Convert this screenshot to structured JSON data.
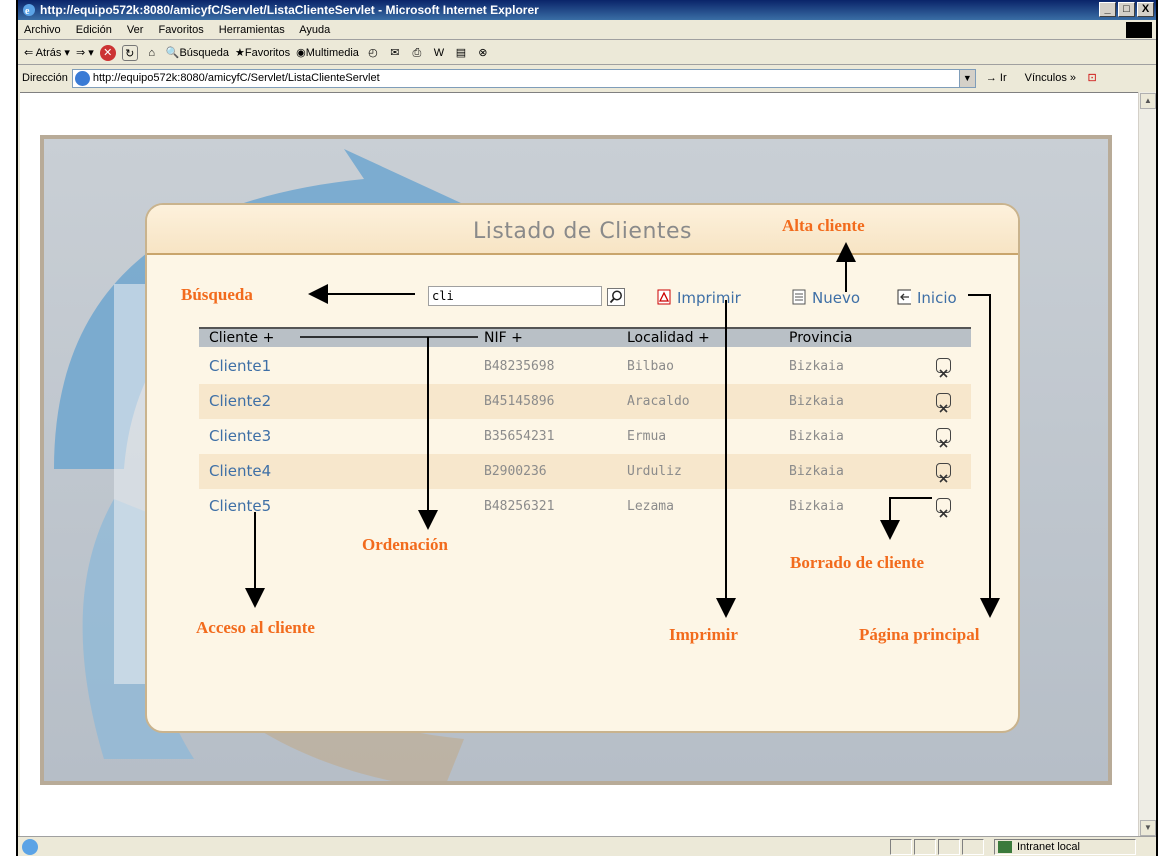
{
  "window": {
    "title": "http://equipo572k:8080/amicyfC/Servlet/ListaClienteServlet - Microsoft Internet Explorer",
    "buttons": [
      "_",
      "□",
      "X"
    ]
  },
  "menu": [
    "Archivo",
    "Edición",
    "Ver",
    "Favoritos",
    "Herramientas",
    "Ayuda"
  ],
  "toolbar": {
    "back": "Atrás",
    "search": "Búsqueda",
    "favorites": "Favoritos",
    "multimedia": "Multimedia"
  },
  "address": {
    "label": "Dirección",
    "url": "http://equipo572k:8080/amicyfC/Servlet/ListaClienteServlet",
    "go": "Ir",
    "links": "Vínculos"
  },
  "status": {
    "zone": "Intranet local"
  },
  "page": {
    "title": "Listado de Clientes",
    "search_value": "cli",
    "print": "Imprimir",
    "new": "Nuevo",
    "home": "Inicio",
    "columns": [
      "Cliente +",
      "NIF +",
      "Localidad +",
      "Provincia"
    ],
    "rows": [
      {
        "cliente": "Cliente1",
        "nif": "B48235698",
        "localidad": "Bilbao",
        "provincia": "Bizkaia"
      },
      {
        "cliente": "Cliente2",
        "nif": "B45145896",
        "localidad": "Aracaldo",
        "provincia": "Bizkaia"
      },
      {
        "cliente": "Cliente3",
        "nif": "B35654231",
        "localidad": "Ermua",
        "provincia": "Bizkaia"
      },
      {
        "cliente": "Cliente4",
        "nif": "B2900236",
        "localidad": "Urduliz",
        "provincia": "Bizkaia"
      },
      {
        "cliente": "Cliente5",
        "nif": "B48256321",
        "localidad": "Lezama",
        "provincia": "Bizkaia"
      }
    ]
  },
  "annotations": {
    "alta": "Alta cliente",
    "busqueda": "Búsqueda",
    "ordenacion": "Ordenación",
    "borrado": "Borrado de cliente",
    "acceso": "Acceso al cliente",
    "imprimir": "Imprimir",
    "pagina": "Página principal"
  },
  "colors": {
    "annotation": "#f26b1d",
    "link": "#3e6fa6",
    "titlebar": "#0a246a"
  }
}
